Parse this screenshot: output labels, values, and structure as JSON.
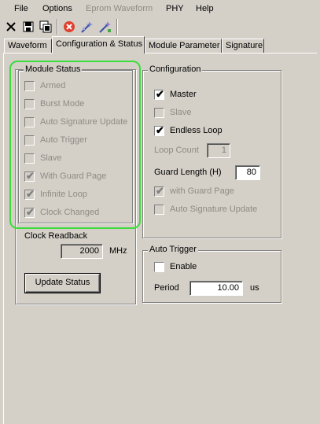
{
  "menu": {
    "items": [
      {
        "label": "File",
        "enabled": true
      },
      {
        "label": "Options",
        "enabled": true
      },
      {
        "label": "Eprom Waveform",
        "enabled": false
      },
      {
        "label": "PHY",
        "enabled": true
      },
      {
        "label": "Help",
        "enabled": true
      }
    ]
  },
  "toolbar": {
    "icons": [
      "close-icon",
      "save-icon",
      "copy-icon",
      "stop-icon",
      "wizard-icon",
      "wizard-alt-icon"
    ]
  },
  "tabs": [
    {
      "label": "Waveform",
      "active": false
    },
    {
      "label": "Configuration & Status",
      "active": true
    },
    {
      "label": "Module Parameter",
      "active": false
    },
    {
      "label": "Signature",
      "active": false
    }
  ],
  "module_status": {
    "title": "Module Status",
    "items": [
      {
        "label": "Armed",
        "checked": false
      },
      {
        "label": "Burst Mode",
        "checked": false
      },
      {
        "label": "Auto Signature Update",
        "checked": false
      },
      {
        "label": "Auto Trigger",
        "checked": false
      },
      {
        "label": "Slave",
        "checked": false
      },
      {
        "label": "With Guard Page",
        "checked": true
      },
      {
        "label": "Infinite Loop",
        "checked": true
      },
      {
        "label": "Clock Changed",
        "checked": true
      }
    ],
    "clock_readback_label": "Clock Readback",
    "clock_readback_value": "2000",
    "clock_unit": "MHz",
    "update_button": "Update Status"
  },
  "configuration": {
    "title": "Configuration",
    "master": {
      "label": "Master",
      "checked": true
    },
    "slave": {
      "label": "Slave",
      "checked": false
    },
    "endless_loop": {
      "label": "Endless Loop",
      "checked": true
    },
    "loop_count_label": "Loop Count",
    "loop_count_value": "1",
    "guard_length_label": "Guard Length (H)",
    "guard_length_value": "80",
    "with_guard_page": {
      "label": "with Guard Page",
      "checked": true
    },
    "auto_signature_update": {
      "label": "Auto Signature Update",
      "checked": false
    }
  },
  "auto_trigger": {
    "title": "Auto Trigger",
    "enable": {
      "label": "Enable",
      "checked": false
    },
    "period_label": "Period",
    "period_value": "10.00",
    "period_unit": "us"
  },
  "colors": {
    "background": "#d4d0c8",
    "highlight": "#3ddc3d",
    "disabled_text": "#8e8b84"
  }
}
